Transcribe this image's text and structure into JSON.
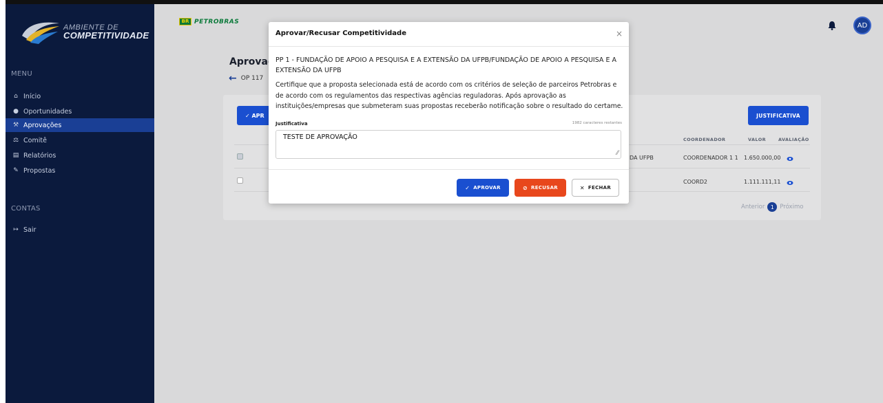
{
  "sidebar": {
    "logo_line1": "AMBIENTE DE",
    "logo_line2": "COMPETITIVIDADE",
    "menu_label": "MENU",
    "items": [
      {
        "label": "Início",
        "icon": "home-icon"
      },
      {
        "label": "Oportunidades",
        "icon": "lightbulb-icon"
      },
      {
        "label": "Aprovações",
        "icon": "gavel-icon"
      },
      {
        "label": "Comitê",
        "icon": "committee-icon"
      },
      {
        "label": "Relatórios",
        "icon": "report-icon"
      },
      {
        "label": "Propostas",
        "icon": "proposal-icon"
      }
    ],
    "contas_label": "CONTAS",
    "logout_label": "Sair"
  },
  "header": {
    "brand": "PETROBRAS",
    "brand_box": "BR",
    "avatar_initials": "AD"
  },
  "page": {
    "title": "Aprovaçã",
    "back_text": "OP 117"
  },
  "card": {
    "approve_button": "✓ APR",
    "justification_button": "JUSTIFICATIVA",
    "columns": [
      "COORDENADOR",
      "VALOR",
      "AVALIAÇÃO"
    ],
    "rows": [
      {
        "org_tail": "DA UFPB",
        "coordinator": "COORDENADOR 1 1",
        "value": "1.650.000,00",
        "checked": true
      },
      {
        "org_tail": "",
        "coordinator": "COORD2",
        "value": "1.111.111,11",
        "checked": false
      }
    ],
    "pager": {
      "previous": "Anterior",
      "current": "1",
      "next": "Próximo"
    }
  },
  "modal": {
    "title": "Aprovar/Recusar Competitividade",
    "close": "×",
    "org": "PP 1 - FUNDAÇÃO DE APOIO A PESQUISA E A EXTENSÃO DA UFPB/FUNDAÇÃO DE APOIO A PESQUISA E A EXTENSÃO DA UFPB",
    "message": "Certifique que a proposta selecionada está de acordo com os critérios de seleção de parceiros Petrobras e de acordo com os regulamentos das respectivas agências reguladoras. Após aprovação as instituições/empresas que submeteram suas propostas receberão notificação sobre o resultado do certame.",
    "justification_label": "Justificativa",
    "chars_remaining": "1982 caracteres restantes",
    "justification_value": "TESTE DE APROVAÇÃO",
    "buttons": {
      "approve": "APROVAR",
      "refuse": "RECUSAR",
      "close": "FECHAR"
    }
  },
  "colors": {
    "sidebar_bg": "#0b1a3d",
    "active_item": "#1a3f95",
    "primary": "#1a4fd0",
    "danger": "#e8471c"
  }
}
